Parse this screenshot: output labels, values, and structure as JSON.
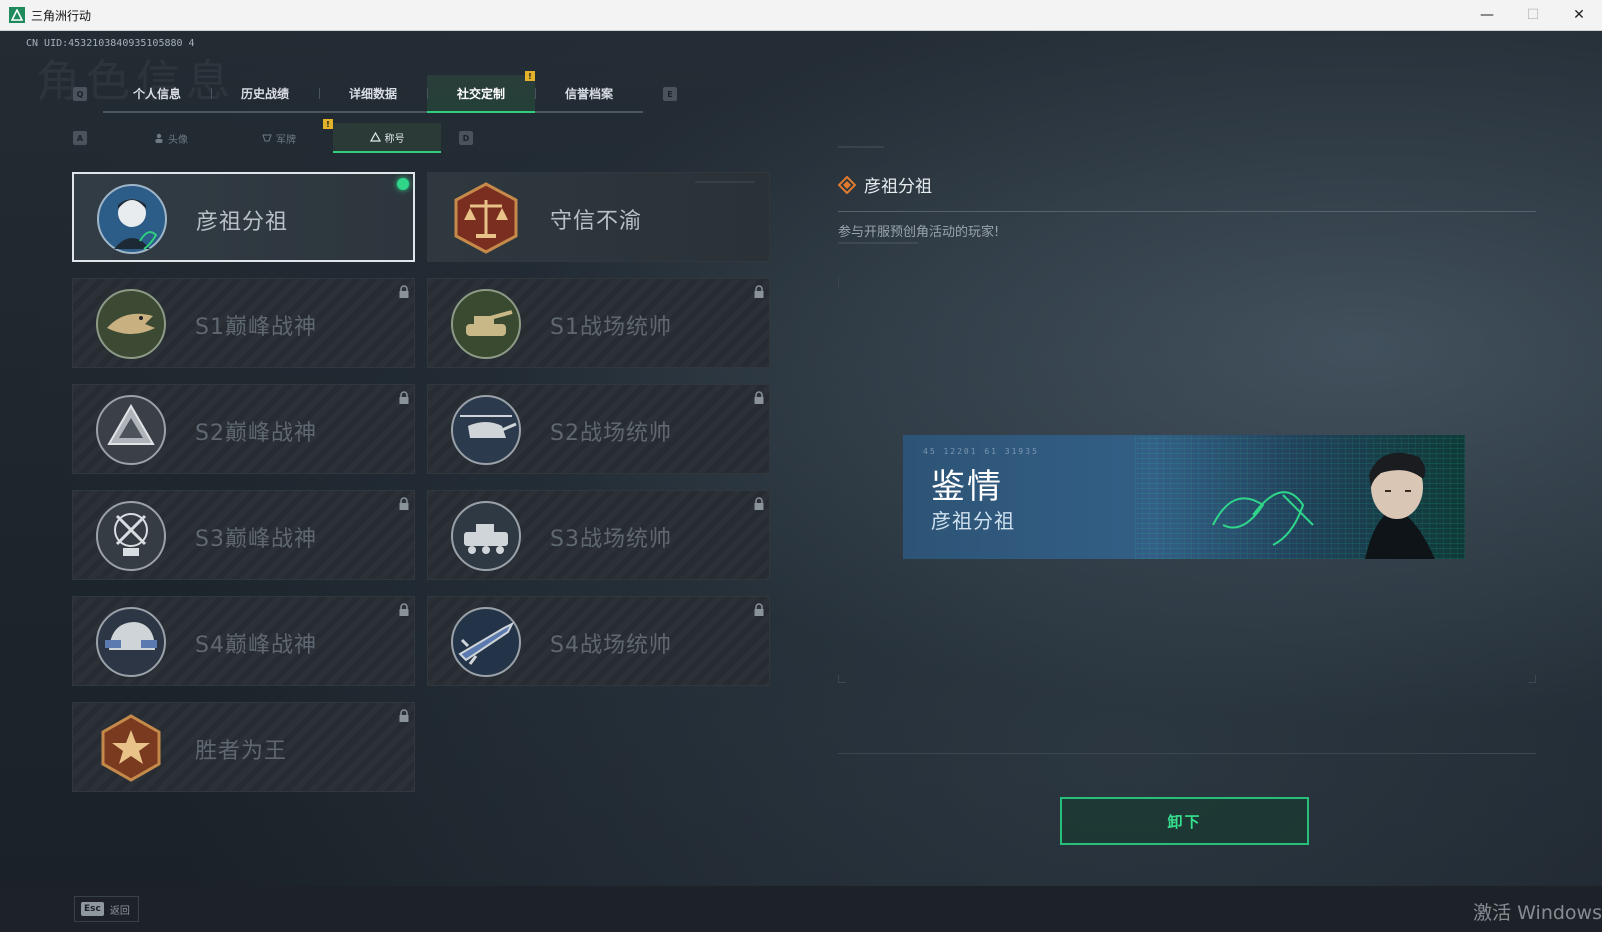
{
  "window": {
    "title": "三角洲行动",
    "controls": [
      "—",
      "☐",
      "✕"
    ]
  },
  "header": {
    "uid": "CN UID:4532103840935105880 4",
    "bg_title": "角色信息"
  },
  "top_tabs": {
    "left_key": "Q",
    "right_key": "E",
    "items": [
      {
        "label": "个人信息"
      },
      {
        "label": "历史战绩"
      },
      {
        "label": "详细数据"
      },
      {
        "label": "社交定制"
      },
      {
        "label": "信誉档案"
      }
    ],
    "active_index": 3,
    "warn_badge": "!"
  },
  "sub_tabs": {
    "left_key": "A",
    "right_key": "D",
    "items": [
      {
        "label": "头像"
      },
      {
        "label": "军牌"
      },
      {
        "label": "称号"
      }
    ],
    "active_index": 2,
    "warn_badge": "!"
  },
  "titles": [
    {
      "label": "彦祖分祖",
      "locked": false,
      "selected": true,
      "equipped": true
    },
    {
      "label": "守信不渝",
      "locked": false,
      "selected": false,
      "equipped": false
    },
    {
      "label": "S1巅峰战神",
      "locked": true
    },
    {
      "label": "S1战场统帅",
      "locked": true
    },
    {
      "label": "S2巅峰战神",
      "locked": true
    },
    {
      "label": "S2战场统帅",
      "locked": true
    },
    {
      "label": "S3巅峰战神",
      "locked": true
    },
    {
      "label": "S3战场统帅",
      "locked": true
    },
    {
      "label": "S4巅峰战神",
      "locked": true
    },
    {
      "label": "S4战场统帅",
      "locked": true
    },
    {
      "label": "胜者为王",
      "locked": true
    }
  ],
  "detail": {
    "title": "彦祖分祖",
    "description": "参与开服预创角活动的玩家!",
    "preview": {
      "code": "45 12201  61 31935",
      "main_text": "鉴情",
      "sub_text": "彦祖分祖"
    },
    "action_button": "卸下"
  },
  "footer": {
    "esc_key": "Esc",
    "esc_label": "返回",
    "watermark": "激活 Windows"
  },
  "colors": {
    "accent": "#2fcf7f",
    "warn": "#e3b12a"
  }
}
